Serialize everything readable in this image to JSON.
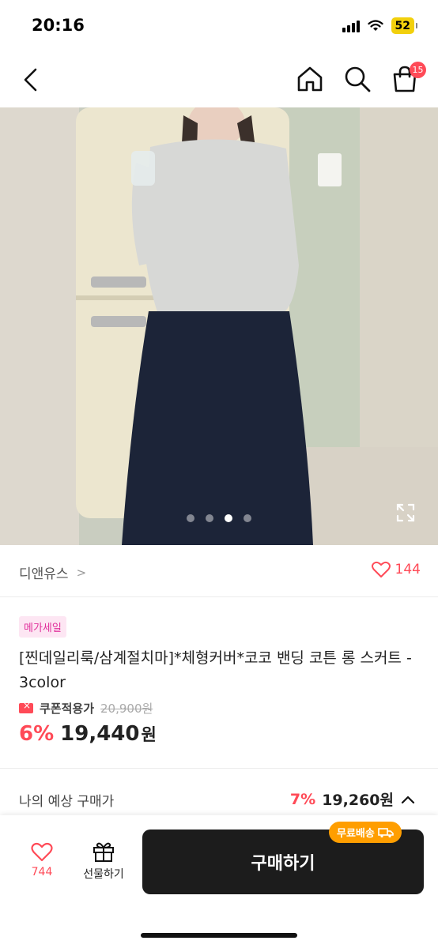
{
  "status_bar": {
    "time": "20:16",
    "battery": "52"
  },
  "nav": {
    "cart_count": "15"
  },
  "gallery": {
    "slide_count": 4,
    "active_slide": 3
  },
  "brand": {
    "name": "디앤유스",
    "chevron": ">",
    "wish_count": "144"
  },
  "product": {
    "badge": "메가세일",
    "title": "[찐데일리룩/삼계절치마]*체형커버*코코 밴딩 코튼 롱 스커트 - 3color",
    "coupon_label": "쿠폰적용가",
    "original_price": "20,900원",
    "discount": "6%",
    "price": "19,440",
    "price_unit": "원"
  },
  "expected": {
    "label": "나의 예상 구매가",
    "discount": "7%",
    "price": "19,260원"
  },
  "bottom_bar": {
    "wish_count": "744",
    "gift_label": "선물하기",
    "buy_label": "구매하기",
    "free_shipping": "무료배송"
  },
  "colors": {
    "accent": "#ff4a57",
    "buy_button": "#1c1c1c",
    "badge_text": "#e0309b",
    "free_ship": "#ff9e00"
  }
}
